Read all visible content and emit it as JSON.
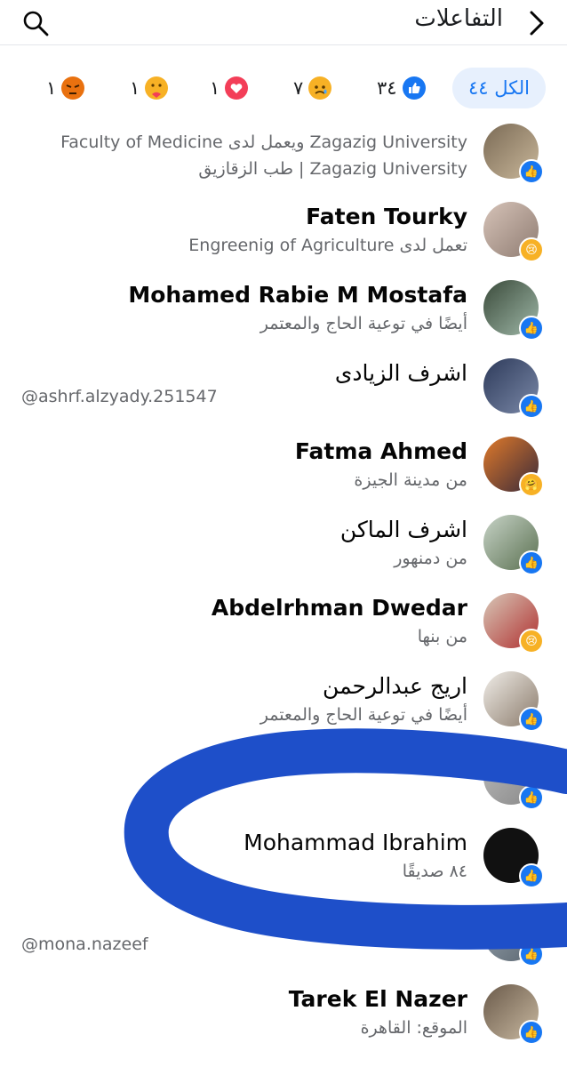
{
  "header": {
    "title": "التفاعلات"
  },
  "tabs": [
    {
      "label": "الكل ٤٤"
    },
    {
      "label": "٣٤",
      "icon": "like-icon"
    },
    {
      "label": "٧",
      "icon": "sad-icon"
    },
    {
      "label": "١",
      "icon": "love-icon"
    },
    {
      "label": "١",
      "icon": "care-icon"
    },
    {
      "label": "١",
      "icon": "angry-icon"
    }
  ],
  "people": [
    {
      "name": "",
      "line1": "Zagazig University ويعمل لدى Faculty of Medicine",
      "line2": "Zagazig University | طب الزقازيق",
      "reaction": "like"
    },
    {
      "name": "Faten Tourky",
      "line1": "تعمل لدى Engreenig of Agriculture",
      "reaction": "sad"
    },
    {
      "name": "Mohamed Rabie M Mostafa",
      "line1": "أيضًا في توعية الحاج والمعتمر",
      "reaction": "like"
    },
    {
      "name": "اشرف الزيادى",
      "line1": "",
      "reaction": "like"
    },
    {
      "name": "Fatma Ahmed",
      "line1": "من مدينة الجيزة",
      "reaction": "care"
    },
    {
      "name": "اشرف الماكن",
      "line1": "من دمنهور",
      "reaction": "like"
    },
    {
      "name": "Abdelrhman Dwedar",
      "line1": "من بنها",
      "reaction": "sad"
    },
    {
      "name": "اريج عبدالرحمن",
      "line1": "أيضًا في توعية الحاج والمعتمر",
      "reaction": "like"
    },
    {
      "name": "Mohammad Ibrahim",
      "line1": "٨٤ صديقًا",
      "reaction": "like"
    },
    {
      "name": "Tarek El Nazer",
      "line1": "الموقع: القاهرة",
      "reaction": "like"
    }
  ],
  "handles": {
    "ashrf": "@ashrf.alzyady.251547",
    "mona": "@mona.nazeef"
  },
  "colors": {
    "accent": "#1877f2",
    "scribble": "#1e4fc9"
  }
}
